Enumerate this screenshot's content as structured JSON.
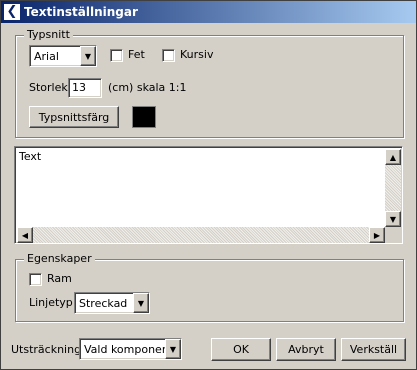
{
  "window": {
    "title": "Textinställningar"
  },
  "font_group": {
    "legend": "Typsnitt",
    "font_select": {
      "value": "Arial"
    },
    "bold": {
      "label": "Fet",
      "checked": false
    },
    "italic": {
      "label": "Kursiv",
      "checked": false
    },
    "size_label": "Storlek",
    "size_value": "13",
    "size_unit_label": "(cm) skala 1:1",
    "color_button": "Typsnittsfärg",
    "color_value": "#000000"
  },
  "text_area": {
    "value": "Text"
  },
  "properties_group": {
    "legend": "Egenskaper",
    "frame": {
      "label": "Ram",
      "checked": false
    },
    "line_type_label": "Linjetyp",
    "line_type_select": {
      "value": "Streckad"
    }
  },
  "footer": {
    "extent_label": "Utsträckning",
    "extent_select": {
      "value": "Vald komponent"
    },
    "ok_button": "OK",
    "cancel_button": "Avbryt",
    "apply_button": "Verkställ"
  },
  "icons": {
    "app": "back-arrow-icon",
    "dropdown": "chevron-down-icon",
    "scroll_up": "arrow-up-icon",
    "scroll_down": "arrow-down-icon",
    "scroll_left": "arrow-left-icon",
    "scroll_right": "arrow-right-icon"
  }
}
